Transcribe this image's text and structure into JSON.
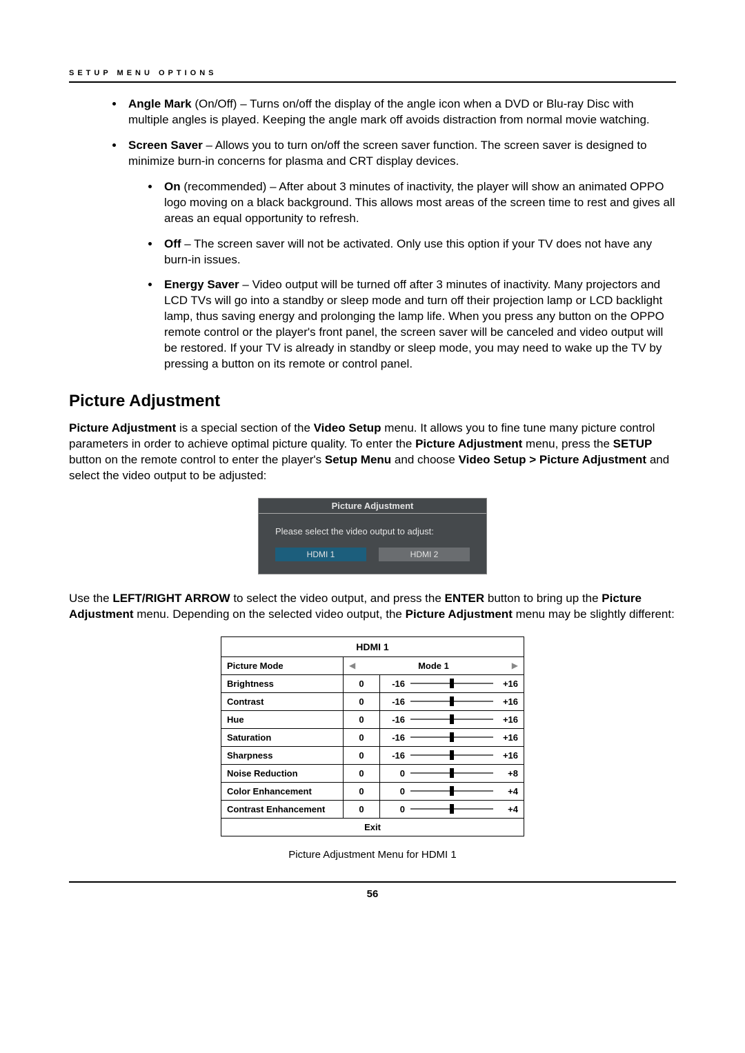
{
  "header": {
    "label": "SETUP MENU OPTIONS"
  },
  "bullets": {
    "angle_mark": {
      "title": "Angle Mark",
      "sub": "(On/Off)",
      "text": " – Turns on/off the display of the angle icon when a DVD or Blu-ray Disc with multiple angles is played. Keeping the angle mark off avoids distraction from normal movie watching."
    },
    "screen_saver": {
      "title": "Screen Saver",
      "text": " – Allows you to turn on/off the screen saver function. The screen saver is designed to minimize burn-in concerns for plasma and CRT display devices.",
      "on": {
        "title": "On",
        "sub": "(recommended)",
        "text": " – After about 3 minutes of inactivity, the player will show an animated OPPO logo moving on a black background. This allows most areas of the screen time to rest and gives all areas an equal opportunity to refresh."
      },
      "off": {
        "title": "Off",
        "text": " – The screen saver will not be activated. Only use this option if your TV does not have any burn-in issues."
      },
      "energy": {
        "title": "Energy Saver",
        "text": " – Video output will be turned off after 3 minutes of inactivity. Many projectors and LCD TVs will go into a standby or sleep mode and turn off their projection lamp or LCD backlight lamp, thus saving energy and prolonging the lamp life.  When you press any button on the OPPO remote control or the player's front panel, the screen saver will be canceled and video output will be restored. If your TV is already in standby or sleep mode, you may need to wake up the TV by pressing a button on its remote or control panel."
      }
    }
  },
  "section": {
    "heading": "Picture Adjustment",
    "intro_parts": {
      "p1a": "Picture Adjustment",
      "p1b": " is a special section of the ",
      "p1c": "Video Setup",
      "p1d": " menu. It allows you to fine tune many picture control parameters in order to achieve optimal picture quality. To enter the ",
      "p1e": "Picture Adjustment",
      "p1f": " menu, press the ",
      "p1g": "SETUP",
      "p1h": " button on the remote control to enter the player's ",
      "p1i": "Setup Menu",
      "p1j": " and choose ",
      "p1k": "Video Setup > Picture Adjustment",
      "p1l": " and select the video output to be adjusted:"
    },
    "second_para": {
      "a": "Use the ",
      "b": "LEFT/RIGHT ARROW",
      "c": " to select the video output, and press the ",
      "d": "ENTER",
      "e": " button to bring up the ",
      "f": "Picture Adjustment",
      "g": " menu. Depending on the selected video output, the ",
      "h": "Picture Adjustment",
      "i": " menu may be slightly different:"
    }
  },
  "dialog1": {
    "title": "Picture Adjustment",
    "prompt": "Please select the video output to adjust:",
    "btn1": "HDMI 1",
    "btn2": "HDMI 2"
  },
  "hdmi_table": {
    "title": "HDMI 1",
    "mode_label": "Picture Mode",
    "mode_value": "Mode 1",
    "rows": [
      {
        "label": "Brightness",
        "val": "0",
        "min": "-16",
        "max": "+16",
        "pos": 50
      },
      {
        "label": "Contrast",
        "val": "0",
        "min": "-16",
        "max": "+16",
        "pos": 50
      },
      {
        "label": "Hue",
        "val": "0",
        "min": "-16",
        "max": "+16",
        "pos": 50
      },
      {
        "label": "Saturation",
        "val": "0",
        "min": "-16",
        "max": "+16",
        "pos": 50
      },
      {
        "label": "Sharpness",
        "val": "0",
        "min": "-16",
        "max": "+16",
        "pos": 50
      },
      {
        "label": "Noise Reduction",
        "val": "0",
        "min": "0",
        "max": "+8",
        "pos": 50
      },
      {
        "label": "Color Enhancement",
        "val": "0",
        "min": "0",
        "max": "+4",
        "pos": 50
      },
      {
        "label": "Contrast Enhancement",
        "val": "0",
        "min": "0",
        "max": "+4",
        "pos": 50
      }
    ],
    "exit": "Exit"
  },
  "caption": "Picture Adjustment Menu for HDMI 1",
  "page_number": "56"
}
